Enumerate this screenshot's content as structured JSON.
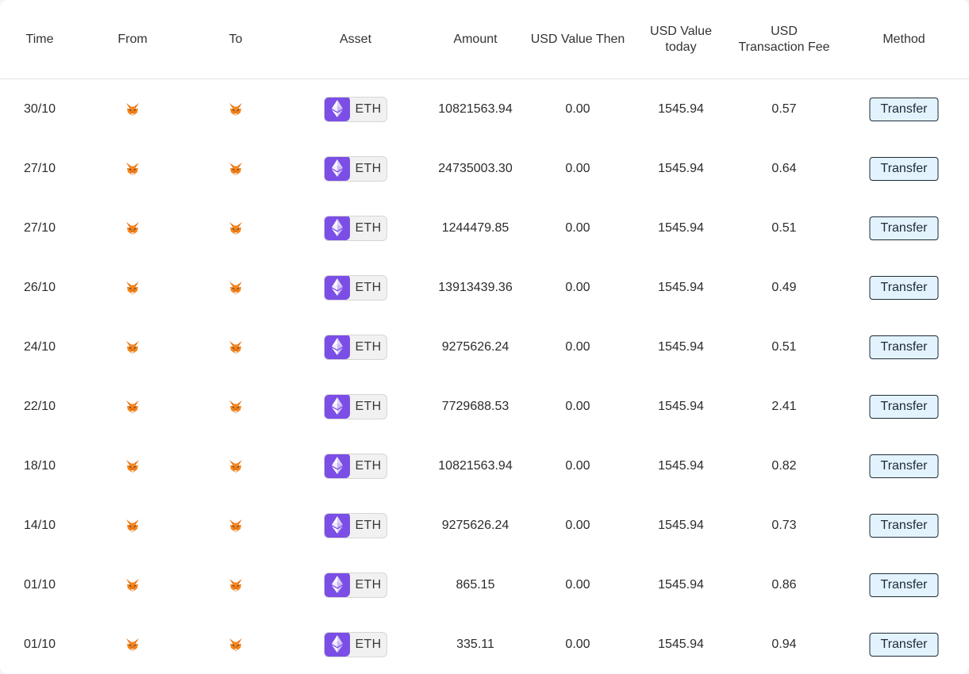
{
  "columns": {
    "time": "Time",
    "from": "From",
    "to": "To",
    "asset": "Asset",
    "amount": "Amount",
    "usd_then": "USD Value Then",
    "usd_today": "USD Value\ntoday",
    "fee": "USD\nTransaction Fee",
    "method": "Method"
  },
  "rows": [
    {
      "time": "30/10",
      "asset": "ETH",
      "amount": "10821563.94",
      "usd_then": "0.00",
      "usd_today": "1545.94",
      "fee": "0.57",
      "method": "Transfer"
    },
    {
      "time": "27/10",
      "asset": "ETH",
      "amount": "24735003.30",
      "usd_then": "0.00",
      "usd_today": "1545.94",
      "fee": "0.64",
      "method": "Transfer"
    },
    {
      "time": "27/10",
      "asset": "ETH",
      "amount": "1244479.85",
      "usd_then": "0.00",
      "usd_today": "1545.94",
      "fee": "0.51",
      "method": "Transfer"
    },
    {
      "time": "26/10",
      "asset": "ETH",
      "amount": "13913439.36",
      "usd_then": "0.00",
      "usd_today": "1545.94",
      "fee": "0.49",
      "method": "Transfer"
    },
    {
      "time": "24/10",
      "asset": "ETH",
      "amount": "9275626.24",
      "usd_then": "0.00",
      "usd_today": "1545.94",
      "fee": "0.51",
      "method": "Transfer"
    },
    {
      "time": "22/10",
      "asset": "ETH",
      "amount": "7729688.53",
      "usd_then": "0.00",
      "usd_today": "1545.94",
      "fee": "2.41",
      "method": "Transfer"
    },
    {
      "time": "18/10",
      "asset": "ETH",
      "amount": "10821563.94",
      "usd_then": "0.00",
      "usd_today": "1545.94",
      "fee": "0.82",
      "method": "Transfer"
    },
    {
      "time": "14/10",
      "asset": "ETH",
      "amount": "9275626.24",
      "usd_then": "0.00",
      "usd_today": "1545.94",
      "fee": "0.73",
      "method": "Transfer"
    },
    {
      "time": "01/10",
      "asset": "ETH",
      "amount": "865.15",
      "usd_then": "0.00",
      "usd_today": "1545.94",
      "fee": "0.86",
      "method": "Transfer"
    },
    {
      "time": "01/10",
      "asset": "ETH",
      "amount": "335.11",
      "usd_then": "0.00",
      "usd_today": "1545.94",
      "fee": "0.94",
      "method": "Transfer"
    }
  ],
  "icons": {
    "from": "metamask-fox-icon",
    "to": "metamask-fox-icon",
    "asset": "ethereum-icon"
  },
  "colors": {
    "eth_purple": "#7b4ee6",
    "method_button_bg": "#e3f3fd",
    "fox_orange": "#e2761b"
  }
}
